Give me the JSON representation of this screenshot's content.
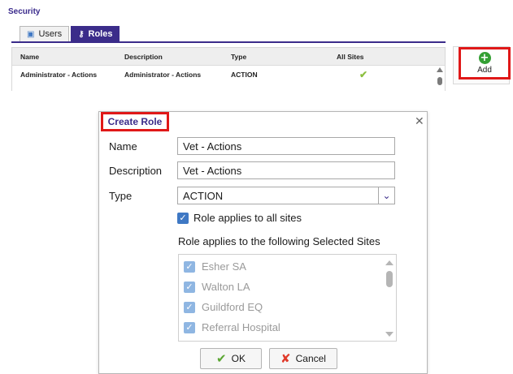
{
  "page": {
    "section_title": "Security",
    "tabs": [
      {
        "label": "Users",
        "icon": "users-icon"
      },
      {
        "label": "Roles",
        "icon": "key-icon",
        "active": true
      }
    ]
  },
  "grid": {
    "columns": [
      "Name",
      "Description",
      "Type",
      "All Sites"
    ],
    "rows": [
      {
        "name": "Administrator - Actions",
        "description": "Administrator - Actions",
        "type": "ACTION",
        "all_sites": true
      }
    ]
  },
  "add_button": {
    "label": "Add",
    "icon": "plus-circle-icon"
  },
  "dialog": {
    "title": "Create Role",
    "fields": {
      "name_label": "Name",
      "name_value": "Vet - Actions",
      "description_label": "Description",
      "description_value": "Vet - Actions",
      "type_label": "Type",
      "type_value": "ACTION"
    },
    "all_sites_checkbox": {
      "label": "Role applies to all sites",
      "checked": true
    },
    "selected_sites_label": "Role applies to the following Selected Sites",
    "sites": [
      {
        "label": "Esher SA",
        "checked": true
      },
      {
        "label": "Walton LA",
        "checked": true
      },
      {
        "label": "Guildford EQ",
        "checked": true
      },
      {
        "label": "Referral Hospital",
        "checked": true
      }
    ],
    "ok_label": "OK",
    "cancel_label": "Cancel"
  },
  "colors": {
    "accent": "#3b2c8a",
    "highlight_box": "#e01818",
    "check_green": "#8cbf3f",
    "checkbox_blue": "#3f78c4"
  }
}
